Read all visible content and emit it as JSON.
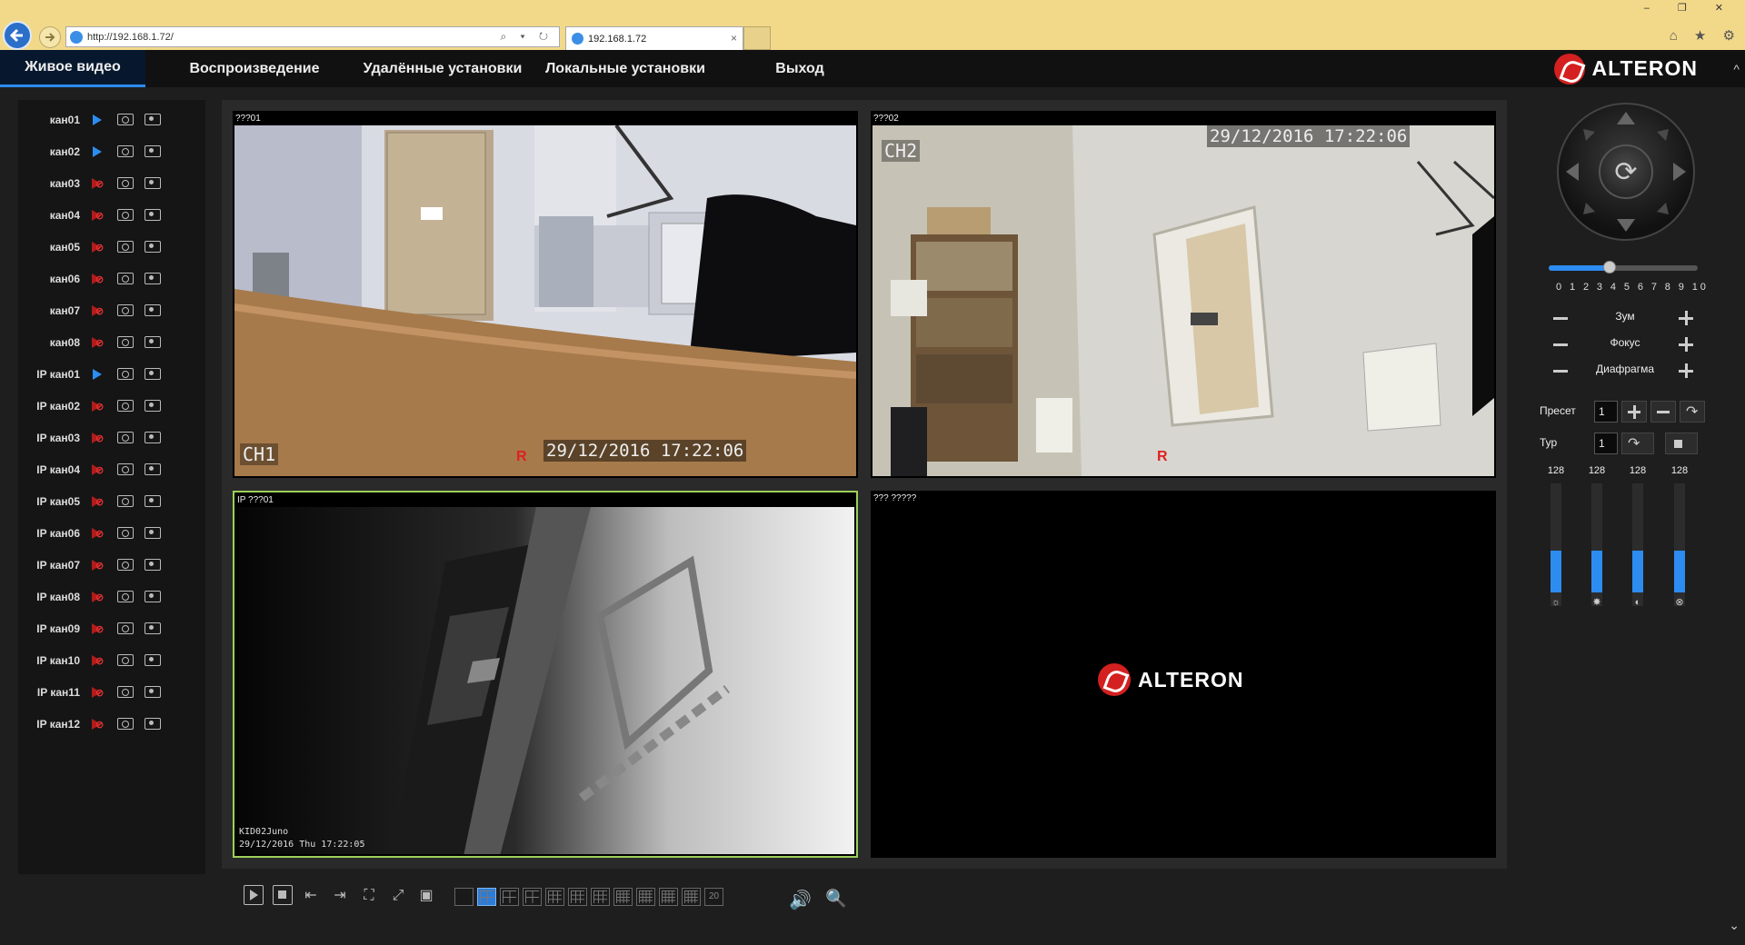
{
  "browser": {
    "url": "http://192.168.1.72/",
    "tab_title": "192.168.1.72",
    "tab_close": "×",
    "address_tools": "⌕ ▾ ↻",
    "window_controls": "– ❐ ✕",
    "toolbar_icons": "⌂ ★ ⚙"
  },
  "nav": {
    "items": [
      {
        "label": "Живое видео",
        "active": true
      },
      {
        "label": "Воспроизведение"
      },
      {
        "label": "Удалённые установки"
      },
      {
        "label": "Локальные установки"
      },
      {
        "label": "Выход"
      }
    ],
    "logo_text": "ALTERON",
    "scroll_up": "^",
    "scroll_down": "⌄"
  },
  "channels": [
    {
      "label": "кан01",
      "active": true
    },
    {
      "label": "кан02",
      "active": true
    },
    {
      "label": "кан03",
      "active": false
    },
    {
      "label": "кан04",
      "active": false
    },
    {
      "label": "кан05",
      "active": false
    },
    {
      "label": "кан06",
      "active": false
    },
    {
      "label": "кан07",
      "active": false
    },
    {
      "label": "кан08",
      "active": false
    },
    {
      "label": "IP кан01",
      "active": true
    },
    {
      "label": "IP кан02",
      "active": false
    },
    {
      "label": "IP кан03",
      "active": false
    },
    {
      "label": "IP кан04",
      "active": false
    },
    {
      "label": "IP кан05",
      "active": false
    },
    {
      "label": "IP кан06",
      "active": false
    },
    {
      "label": "IP кан07",
      "active": false
    },
    {
      "label": "IP кан08",
      "active": false
    },
    {
      "label": "IP кан09",
      "active": false
    },
    {
      "label": "IP кан10",
      "active": false
    },
    {
      "label": "IP кан11",
      "active": false
    },
    {
      "label": "IP кан12",
      "active": false
    }
  ],
  "panes": [
    {
      "title": "???01",
      "osd_channel": "CH1",
      "osd_time": "29/12/2016 17:22:06",
      "rec_mark": "R"
    },
    {
      "title": "???02",
      "osd_channel": "CH2",
      "osd_time": "29/12/2016 17:22:06",
      "rec_mark": "R"
    },
    {
      "title": "IP ???01",
      "osd_name": "KID02Juno",
      "osd_time": "29/12/2016 Thu 17:22:05"
    },
    {
      "title": "??? ?????",
      "logo_text": "ALTERON"
    }
  ],
  "toolbar": {
    "layout_last": "20",
    "volume_icon": "🔊",
    "search_icon": "🔍"
  },
  "ptz": {
    "center_icon": "⟳",
    "speed_scale": "0 1 2 3 4 5 6 7 8 9 10",
    "speed_value": 4,
    "zoom_label": "Зум",
    "focus_label": "Фокус",
    "iris_label": "Диафрагма",
    "preset_label": "Пресет",
    "preset_value": "1",
    "tour_label": "Тур",
    "tour_value": "1"
  },
  "image_adjust": [
    {
      "value": "128",
      "icon": "brightness-icon",
      "glyph": "☼",
      "level": 0.38
    },
    {
      "value": "128",
      "icon": "contrast-icon",
      "glyph": "✸",
      "level": 0.38
    },
    {
      "value": "128",
      "icon": "saturation-icon",
      "glyph": "◐",
      "level": 0.38
    },
    {
      "value": "128",
      "icon": "hue-icon",
      "glyph": "⊗",
      "level": 0.38
    }
  ],
  "colors": {
    "accent": "#2d8cf0",
    "alarm": "#d42020",
    "selected_border": "#9ccf5a"
  }
}
